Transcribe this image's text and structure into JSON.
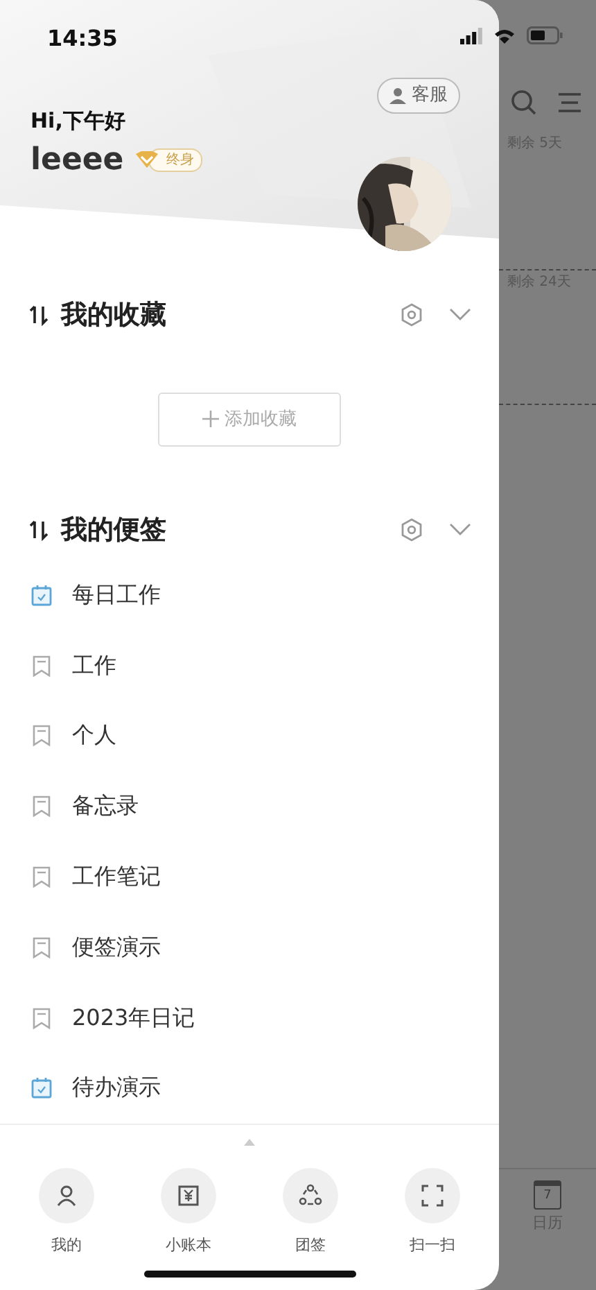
{
  "status_bar": {
    "time": "14:35"
  },
  "header": {
    "greeting": "Hi,下午好",
    "username": "leeee",
    "vip_badge": "终身",
    "service_button": "客服"
  },
  "favorites": {
    "title": "我的收藏",
    "add_button": "添加收藏"
  },
  "notes": {
    "title": "我的便签",
    "items": [
      {
        "label": "每日工作",
        "kind": "todo"
      },
      {
        "label": "工作",
        "kind": "note"
      },
      {
        "label": "个人",
        "kind": "note"
      },
      {
        "label": "备忘录",
        "kind": "note"
      },
      {
        "label": "工作笔记",
        "kind": "note"
      },
      {
        "label": "便签演示",
        "kind": "note"
      },
      {
        "label": "2023年日记",
        "kind": "note"
      },
      {
        "label": "待办演示",
        "kind": "todo"
      }
    ]
  },
  "bottom_nav": [
    {
      "label": "我的",
      "kind": "profile"
    },
    {
      "label": "小账本",
      "kind": "ledger"
    },
    {
      "label": "团签",
      "kind": "team"
    },
    {
      "label": "扫一扫",
      "kind": "scan"
    }
  ],
  "background": {
    "remaining": [
      "剩余 5天",
      "剩余 24天"
    ],
    "calendar_day": "7",
    "calendar_label": "日历"
  }
}
